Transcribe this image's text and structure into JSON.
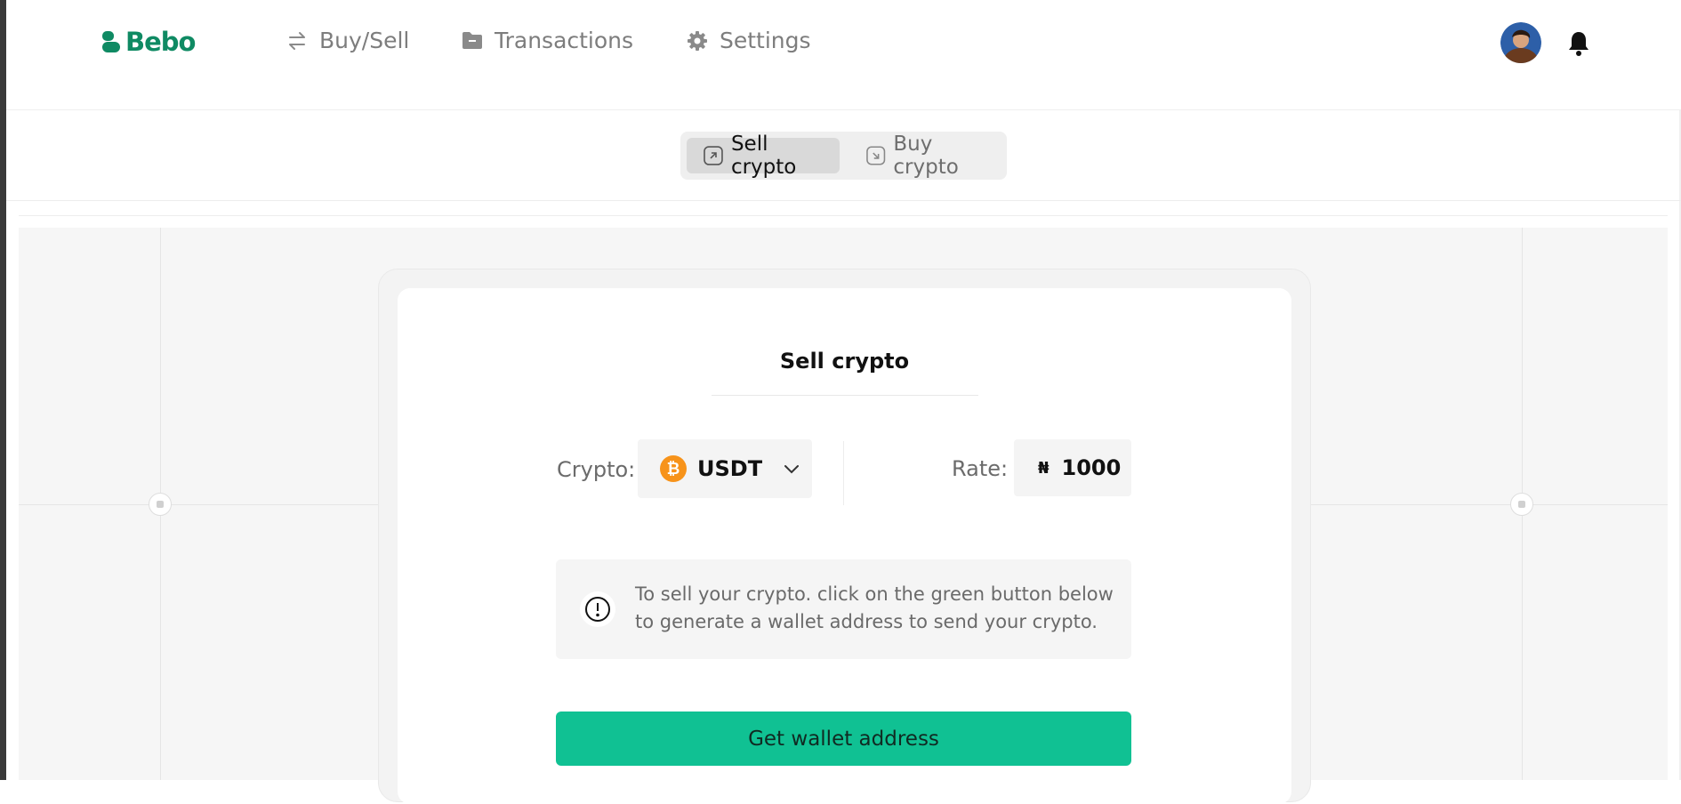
{
  "brand": {
    "name": "Bebo",
    "color": "#0f8a63"
  },
  "nav": {
    "items": [
      {
        "label": "Buy/Sell",
        "icon": "swap-arrows-icon"
      },
      {
        "label": "Transactions",
        "icon": "folder-icon"
      },
      {
        "label": "Settings",
        "icon": "gear-icon"
      }
    ]
  },
  "header": {
    "avatar": "user-avatar",
    "notifications_icon": "bell-icon"
  },
  "tabs": [
    {
      "label": "Sell crypto",
      "icon": "arrow-up-right-box-icon",
      "active": true
    },
    {
      "label": "Buy crypto",
      "icon": "arrow-down-right-box-icon",
      "active": false
    }
  ],
  "card": {
    "title": "Sell crypto",
    "crypto_label": "Crypto:",
    "crypto_value": "USDT",
    "crypto_icon": "bitcoin-coin-icon",
    "coin_symbol": "₿",
    "rate_label": "Rate:",
    "rate_currency": "₦",
    "rate_value": "1000",
    "info_text": "To sell your crypto. click on the green button below to generate a wallet address to send your crypto.",
    "cta_label": "Get wallet address"
  },
  "colors": {
    "accent": "#10c193",
    "coin": "#f7931a",
    "muted_text": "#7d7d7d"
  }
}
